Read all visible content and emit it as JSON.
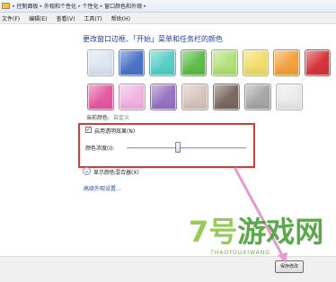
{
  "breadcrumb": [
    "控制面板",
    "外观和个性化",
    "个性化",
    "窗口颜色和外观"
  ],
  "menu": [
    "文件(F)",
    "编辑(E)",
    "查看(V)",
    "工具(T)",
    "帮助(H)"
  ],
  "title": "更改窗口边框、「开始」菜单和任务栏的颜色",
  "swatch_colors": [
    [
      "#dbe7f3",
      "#4c74c8",
      "#58d0c6",
      "#61bd4a",
      "#b5e27c",
      "#f3df6a",
      "#f4a23f",
      "#d7363b"
    ],
    [
      "#e65ca3",
      "#f2b4e2",
      "#9a74c4",
      "#d8c6bc",
      "#7d6a60",
      "#a8a8a8",
      "#ececec"
    ]
  ],
  "current_color": {
    "label": "当前颜色:",
    "value": "自定义"
  },
  "transparency": {
    "label": "启用透明效果(N)",
    "checked": true
  },
  "intensity": {
    "label": "颜色浓度(I):",
    "level": 0.43
  },
  "mixer_label": "显示颜色混合器(X)",
  "advanced_link": "高级外观设置...",
  "save_label": "保存修改",
  "watermark": {
    "logo_a": "7号",
    "logo_b": "游戏网",
    "sub": "7HAOYOUXIWANG"
  },
  "colors": {
    "highlight_box": "#d83a3a",
    "link": "#1e4fa8"
  }
}
